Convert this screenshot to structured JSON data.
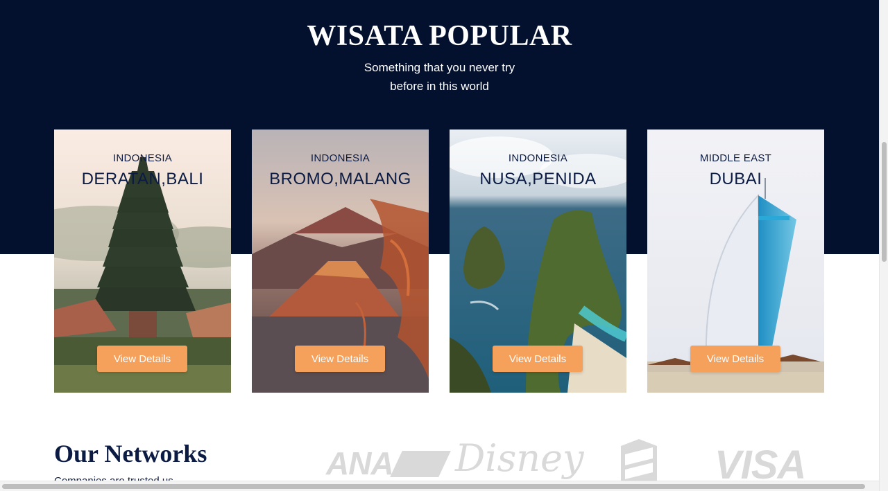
{
  "popular": {
    "title": "WISATA POPULAR",
    "subtitle_line1": "Something that you never try",
    "subtitle_line2": "before in this world"
  },
  "cards": [
    {
      "region": "INDONESIA",
      "place": "DERATAN,BALI",
      "button": "View Details"
    },
    {
      "region": "INDONESIA",
      "place": "BROMO,MALANG",
      "button": "View Details"
    },
    {
      "region": "INDONESIA",
      "place": "NUSA,PENIDA",
      "button": "View Details"
    },
    {
      "region": "MIDDLE EAST",
      "place": "DUBAI",
      "button": "View Details"
    }
  ],
  "networks": {
    "title": "Our Networks",
    "subtitle": "Companies are trusted us",
    "logos": [
      "ANA",
      "Disney",
      "VISA"
    ]
  },
  "colors": {
    "navy": "#03112f",
    "accent": "#f6a15b",
    "heading_text": "#0b1b44"
  }
}
